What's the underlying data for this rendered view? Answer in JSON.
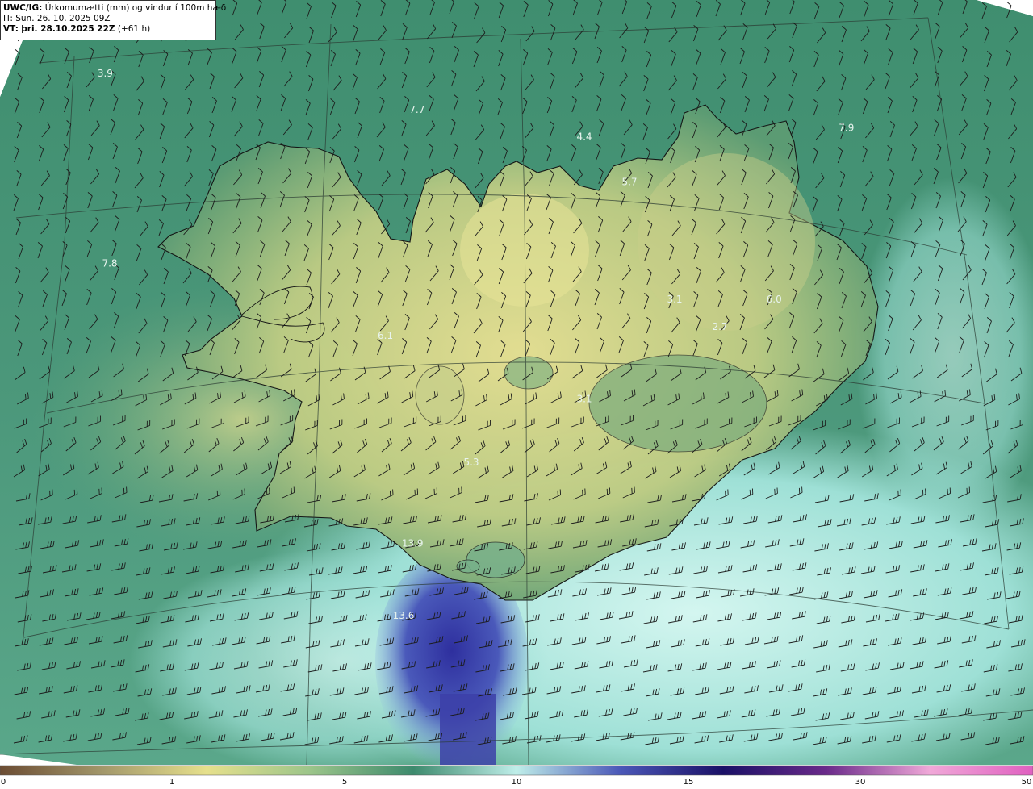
{
  "header": {
    "model_prefix": "UWC/IG:",
    "title": "Úrkomumætti (mm) og vindur í 100m hæð",
    "it_line": "IT: Sun. 26. 10. 2025 09Z",
    "vt_prefix": "VT:",
    "vt_line": "þri. 28.10.2025 22Z",
    "vt_offset": "(+61 h)"
  },
  "map_labels": [
    {
      "text": "3.9",
      "lon": -27.6,
      "lat": 67.9
    },
    {
      "text": "7.7",
      "lon": -20.7,
      "lat": 67.5
    },
    {
      "text": "4.4",
      "lon": -17.0,
      "lat": 67.2
    },
    {
      "text": "7.9",
      "lon": -11.2,
      "lat": 67.3
    },
    {
      "text": "5.7",
      "lon": -16.0,
      "lat": 66.7
    },
    {
      "text": "7.8",
      "lon": -27.5,
      "lat": 65.8
    },
    {
      "text": "3.1",
      "lon": -15.0,
      "lat": 65.4
    },
    {
      "text": "2.7",
      "lon": -14.0,
      "lat": 65.1
    },
    {
      "text": "6.0",
      "lon": -12.8,
      "lat": 65.4
    },
    {
      "text": "6.1",
      "lon": -21.4,
      "lat": 65.0
    },
    {
      "text": "3.1",
      "lon": -17.0,
      "lat": 64.3
    },
    {
      "text": "5.3",
      "lon": -19.5,
      "lat": 63.6
    },
    {
      "text": "13.9",
      "lon": -20.8,
      "lat": 62.7
    },
    {
      "text": "13.6",
      "lon": -21.0,
      "lat": 61.9
    }
  ],
  "colorbar": {
    "ticks": [
      {
        "label": "0",
        "value": 0
      },
      {
        "label": "1",
        "value": 1
      },
      {
        "label": "5",
        "value": 5
      },
      {
        "label": "10",
        "value": 10
      },
      {
        "label": "15",
        "value": 15
      },
      {
        "label": "30",
        "value": 30
      },
      {
        "label": "50",
        "value": 50
      }
    ],
    "stops": [
      "#6b4c33",
      "#a3986b",
      "#e6e08c",
      "#9cc58a",
      "#3d8a6d",
      "#bfeee9",
      "#4b58b8",
      "#1a1066",
      "#6a2a8a",
      "#f0a8d8",
      "#e060c0"
    ]
  },
  "colors": {
    "land_high": "#e2dd8e",
    "land_mid": "#a7c27f",
    "sea_green": "#3c8c6e",
    "sea_light": "#b8ece6",
    "precip_heavy": "#3e46b0",
    "coast": "#1a1a1a"
  }
}
